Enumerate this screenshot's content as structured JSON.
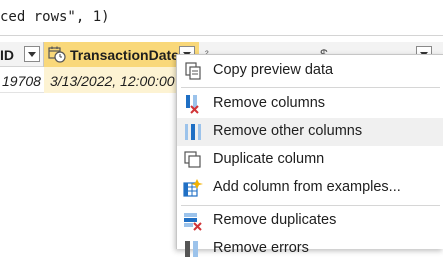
{
  "formula": {
    "text": "ced rows\", 1)"
  },
  "grid": {
    "headers": {
      "id_fragment": "ID",
      "date_column": "TransactionDate"
    },
    "row": {
      "id_value": "19708",
      "date_value": "3/13/2022, 12:00:00"
    }
  },
  "menu": {
    "items": [
      {
        "label": "Copy preview data",
        "icon": "copy-icon"
      },
      {
        "label": "Remove columns",
        "icon": "remove-columns-icon"
      },
      {
        "label": "Remove other columns",
        "icon": "remove-other-columns-icon"
      },
      {
        "label": "Duplicate column",
        "icon": "duplicate-column-icon"
      },
      {
        "label": "Add column from examples...",
        "icon": "add-column-from-examples-icon"
      },
      {
        "label": "Remove duplicates",
        "icon": "remove-duplicates-icon"
      },
      {
        "label": "Remove errors",
        "icon": "remove-errors-icon"
      }
    ]
  },
  "colors": {
    "selected_header": "#f9d87a",
    "accent": "#1f6fc4",
    "remove_red": "#d13438"
  }
}
